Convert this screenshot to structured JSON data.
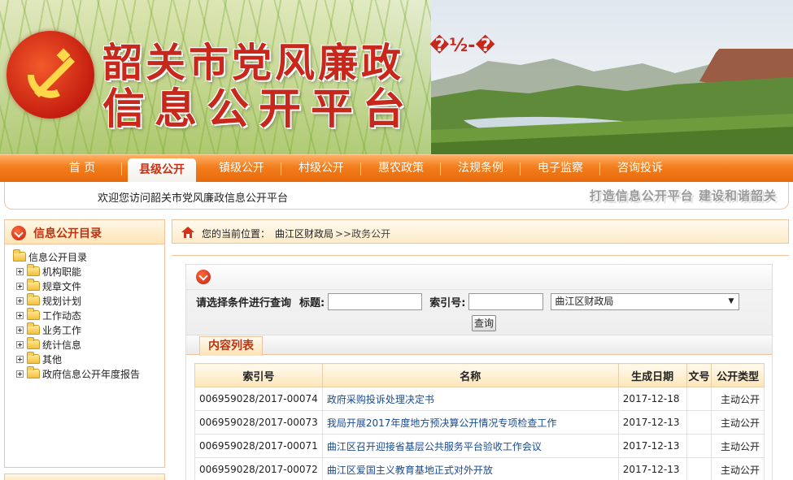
{
  "banner": {
    "title_line1": "韶关市党风廉政",
    "title_line2": "信息公开平台",
    "garbled_text": "�½-�"
  },
  "nav": {
    "items": [
      {
        "label": "首  页",
        "active": false
      },
      {
        "label": "县级公开",
        "active": true
      },
      {
        "label": "镇级公开",
        "active": false
      },
      {
        "label": "村级公开",
        "active": false
      },
      {
        "label": "惠农政策",
        "active": false
      },
      {
        "label": "法规条例",
        "active": false
      },
      {
        "label": "电子监察",
        "active": false
      },
      {
        "label": "咨询投诉",
        "active": false
      }
    ]
  },
  "welcome": {
    "text": "欢迎您访问韶关市党风廉政信息公开平台",
    "slogan": "打造信息公开平台  建设和谐韶关"
  },
  "sidebar": {
    "title": "信息公开目录",
    "root": "信息公开目录",
    "items": [
      "机构职能",
      "规章文件",
      "规划计划",
      "工作动态",
      "业务工作",
      "统计信息",
      "其他",
      "政府信息公开年度报告"
    ]
  },
  "breadcrumb": {
    "label": "您的当前位置：",
    "level1": "曲江区财政局",
    "level2": ">>政务公开"
  },
  "query": {
    "prompt": "请选择条件进行查询",
    "title_label": "标题:",
    "title_value": "",
    "index_label": "索引号:",
    "index_value": "",
    "dept_selected": "曲江区财政局",
    "button": "查询"
  },
  "list": {
    "tab": "内容列表",
    "columns": [
      "索引号",
      "名称",
      "生成日期",
      "文号",
      "公开类型"
    ],
    "rows": [
      {
        "index": "006959028/2017-00074",
        "name": "政府采购投诉处理决定书",
        "date": "2017-12-18",
        "doc_no": "",
        "type": "主动公开"
      },
      {
        "index": "006959028/2017-00073",
        "name": "我局开展2017年度地方预决算公开情况专项检查工作",
        "date": "2017-12-13",
        "doc_no": "",
        "type": "主动公开"
      },
      {
        "index": "006959028/2017-00071",
        "name": "曲江区召开迎接省基层公共服务平台验收工作会议",
        "date": "2017-12-13",
        "doc_no": "",
        "type": "主动公开"
      },
      {
        "index": "006959028/2017-00072",
        "name": "曲江区爱国主义教育基地正式对外开放",
        "date": "2017-12-13",
        "doc_no": "",
        "type": "主动公开"
      }
    ]
  },
  "colors": {
    "accent": "#c8271b",
    "nav_orange": "#f27d1c",
    "link_blue": "#1a4a8e"
  }
}
